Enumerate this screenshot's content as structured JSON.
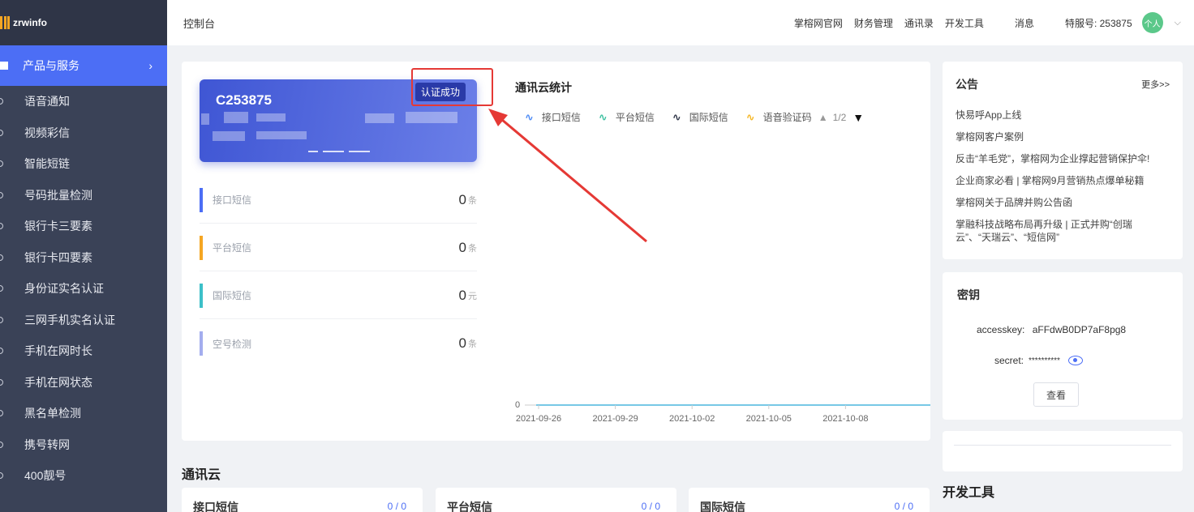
{
  "app": {
    "logo_text": "zrwinfo"
  },
  "header": {
    "title": "控制台",
    "nav": [
      "掌榕网官网",
      "财务管理",
      "通讯录",
      "开发工具"
    ],
    "message": "消息",
    "account": "特服号: 253875",
    "avatar": "个人"
  },
  "sidebar": {
    "active": "产品与服务",
    "items": [
      "语音通知",
      "视频彩信",
      "智能短链",
      "号码批量检测",
      "银行卡三要素",
      "银行卡四要素",
      "身份证实名认证",
      "三网手机实名认证",
      "手机在网时长",
      "手机在网状态",
      "黑名单检测",
      "携号转网",
      "400靓号"
    ]
  },
  "account_card": {
    "number": "C253875",
    "badge": "认证成功"
  },
  "stats": [
    {
      "label": "接口短信",
      "value": "0",
      "unit": "条",
      "color": "#4c6ef5"
    },
    {
      "label": "平台短信",
      "value": "0",
      "unit": "条",
      "color": "#f5a623"
    },
    {
      "label": "国际短信",
      "value": "0",
      "unit": "元",
      "color": "#3cc0c8"
    },
    {
      "label": "空号检测",
      "value": "0",
      "unit": "条",
      "color": "#a3adee"
    }
  ],
  "chart": {
    "title": "通讯云统计",
    "legend": [
      {
        "name": "接口短信",
        "color": "#4c8af5"
      },
      {
        "name": "平台短信",
        "color": "#3cc0a0"
      },
      {
        "name": "国际短信",
        "color": "#2f3547"
      },
      {
        "name": "语音验证码",
        "color": "#f5b623"
      }
    ],
    "pager": "1/2"
  },
  "chart_data": {
    "type": "line",
    "x": [
      "2021-09-26",
      "2021-09-29",
      "2021-10-02",
      "2021-10-05",
      "2021-10-08"
    ],
    "series": [
      {
        "name": "接口短信",
        "values": [
          0,
          0,
          0,
          0,
          0
        ]
      }
    ],
    "ytick": "0"
  },
  "notice": {
    "title": "公告",
    "more": "更多>>",
    "items": [
      "快易呼App上线",
      "掌榕网客户案例",
      "反击“羊毛党”，掌榕网为企业撑起营销保护伞!",
      "企业商家必看 | 掌榕网9月营销热点爆单秘籍",
      "掌榕网关于品牌并购公告函",
      "掌融科技战略布局再升级 | 正式并购“创瑞云”、“天瑞云”、“短信网”"
    ]
  },
  "key": {
    "title": "密钥",
    "accesskey_label": "accesskey:",
    "accesskey_value": "aFFdwB0DP7aF8pg8",
    "secret_label": "secret:",
    "secret_value": "**********",
    "view_button": "查看"
  },
  "dev_tools": "开发工具",
  "bottom": {
    "section_title": "通讯云",
    "cards": [
      {
        "label": "接口短信",
        "ratio": "0 / 0"
      },
      {
        "label": "平台短信",
        "ratio": "0 / 0"
      },
      {
        "label": "国际短信",
        "ratio": "0 / 0"
      }
    ]
  }
}
